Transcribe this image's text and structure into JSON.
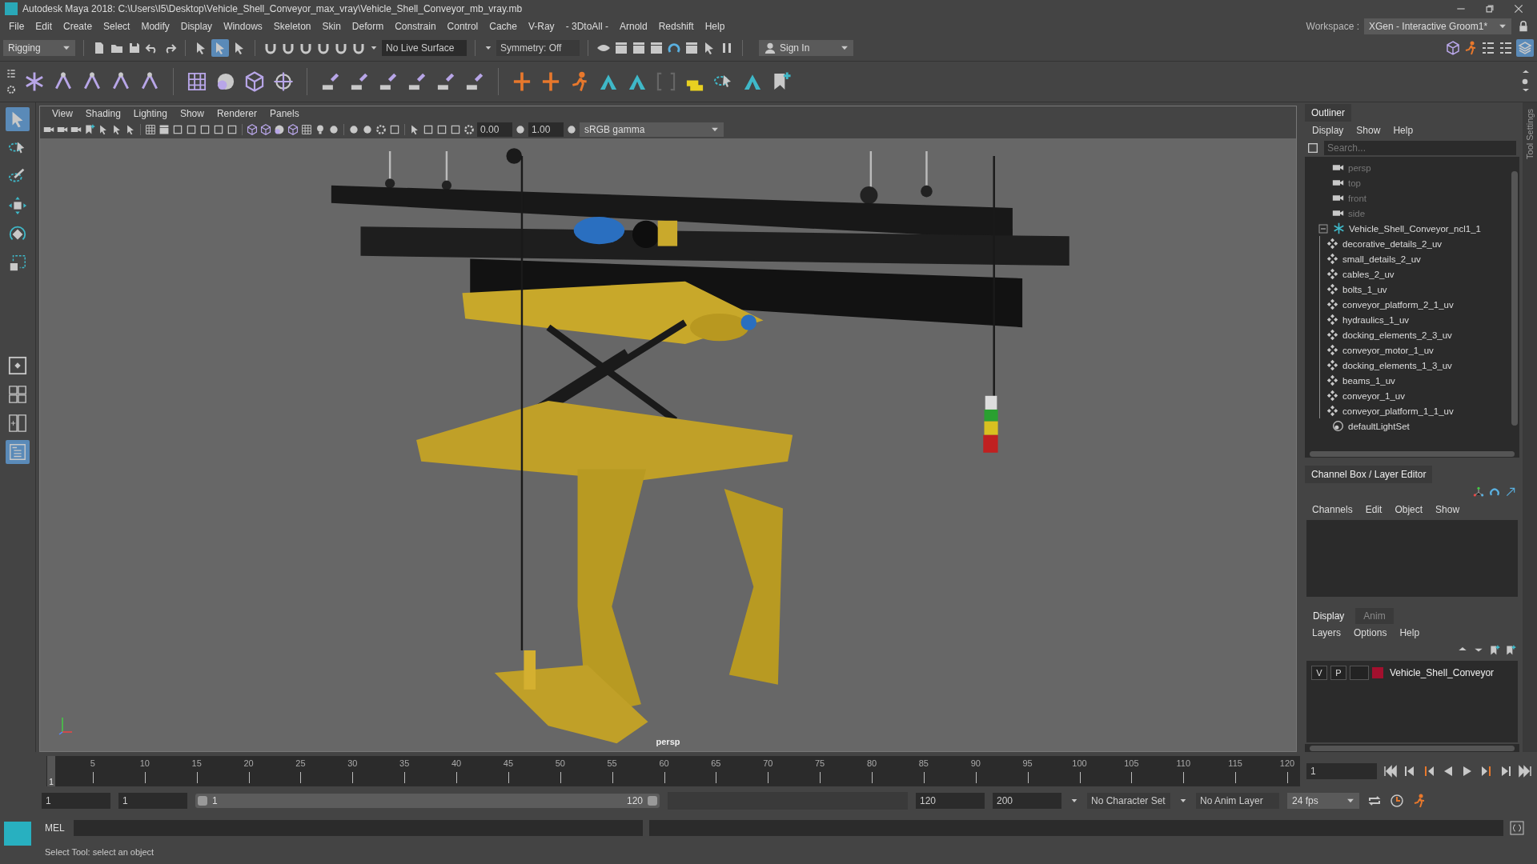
{
  "window": {
    "title": "Autodesk Maya 2018: C:\\Users\\I5\\Desktop\\Vehicle_Shell_Conveyor_max_vray\\Vehicle_Shell_Conveyor_mb_vray.mb"
  },
  "menu_bar": {
    "items": [
      "File",
      "Edit",
      "Create",
      "Select",
      "Modify",
      "Display",
      "Windows",
      "Skeleton",
      "Skin",
      "Deform",
      "Constrain",
      "Control",
      "Cache",
      "V-Ray",
      "- 3DtoAll -",
      "Arnold",
      "Redshift",
      "Help"
    ],
    "workspace_label": "Workspace :",
    "workspace": "XGen - Interactive Groom1*"
  },
  "status_line": {
    "mode": "Rigging",
    "live_surface": "No Live Surface",
    "symmetry": "Symmetry: Off",
    "sign_in": "Sign In"
  },
  "toolbox": {
    "tools": [
      {
        "kind": "select",
        "selected": true
      },
      {
        "kind": "lasso",
        "selected": false
      },
      {
        "kind": "paint",
        "selected": false
      },
      {
        "kind": "move",
        "selected": false
      },
      {
        "kind": "rotate",
        "selected": false
      },
      {
        "kind": "scale",
        "selected": false
      }
    ],
    "layouts": [
      {
        "kind": "single",
        "selected": false
      },
      {
        "kind": "four",
        "selected": false
      },
      {
        "kind": "two",
        "selected": false
      },
      {
        "kind": "outliner",
        "selected": true
      }
    ]
  },
  "viewport": {
    "menu": [
      "View",
      "Shading",
      "Lighting",
      "Show",
      "Renderer",
      "Panels"
    ],
    "exposure": "0.00",
    "gamma": "1.00",
    "color_space": "sRGB gamma",
    "camera": "persp"
  },
  "outliner": {
    "title": "Outliner",
    "menu": [
      "Display",
      "Show",
      "Help"
    ],
    "search": {
      "placeholder": "Search..."
    },
    "items": [
      {
        "label": "persp",
        "kind": "camera"
      },
      {
        "label": "top",
        "kind": "camera"
      },
      {
        "label": "front",
        "kind": "camera"
      },
      {
        "label": "side",
        "kind": "camera"
      },
      {
        "label": "Vehicle_Shell_Conveyor_ncl1_1",
        "kind": "group",
        "expanded": true,
        "children": [
          {
            "label": "decorative_details_2_uv",
            "kind": "mesh"
          },
          {
            "label": "small_details_2_uv",
            "kind": "mesh"
          },
          {
            "label": "cables_2_uv",
            "kind": "mesh"
          },
          {
            "label": "bolts_1_uv",
            "kind": "mesh"
          },
          {
            "label": "conveyor_platform_2_1_uv",
            "kind": "mesh"
          },
          {
            "label": "hydraulics_1_uv",
            "kind": "mesh"
          },
          {
            "label": "docking_elements_2_3_uv",
            "kind": "mesh"
          },
          {
            "label": "conveyor_motor_1_uv",
            "kind": "mesh"
          },
          {
            "label": "docking_elements_1_3_uv",
            "kind": "mesh"
          },
          {
            "label": "beams_1_uv",
            "kind": "mesh"
          },
          {
            "label": "conveyor_1_uv",
            "kind": "mesh"
          },
          {
            "label": "conveyor_platform_1_1_uv",
            "kind": "mesh"
          }
        ]
      },
      {
        "label": "defaultLightSet",
        "kind": "set"
      }
    ]
  },
  "channel_box": {
    "title": "Channel Box / Layer Editor",
    "menu": [
      "Channels",
      "Edit",
      "Object",
      "Show"
    ]
  },
  "layer_editor": {
    "tabs": [
      {
        "label": "Display",
        "selected": true
      },
      {
        "label": "Anim",
        "selected": false
      }
    ],
    "menu": [
      "Layers",
      "Options",
      "Help"
    ],
    "layers": [
      {
        "visible": "V",
        "playback": "P",
        "name": "Vehicle_Shell_Conveyor",
        "color": "#a3102e"
      }
    ]
  },
  "tool_settings": {
    "label": "Tool Settings"
  },
  "time_slider": {
    "ticks": [
      "5",
      "10",
      "15",
      "20",
      "25",
      "30",
      "35",
      "40",
      "45",
      "50",
      "55",
      "60",
      "65",
      "70",
      "75",
      "80",
      "85",
      "90",
      "95",
      "100",
      "105",
      "110",
      "115",
      "120"
    ],
    "current": "1",
    "level": 0,
    "current_frame": "1"
  },
  "range_slider": {
    "start": "1",
    "playback_start": "1",
    "range_start": "1",
    "range_end": "120",
    "level": 1,
    "playback_end": "120",
    "end": "200",
    "character_set": "No Character Set",
    "anim_layer": "No Anim Layer",
    "fps": "24 fps"
  },
  "command_line": {
    "label": "MEL"
  },
  "help_line": {
    "text": "Select Tool: select an object"
  }
}
